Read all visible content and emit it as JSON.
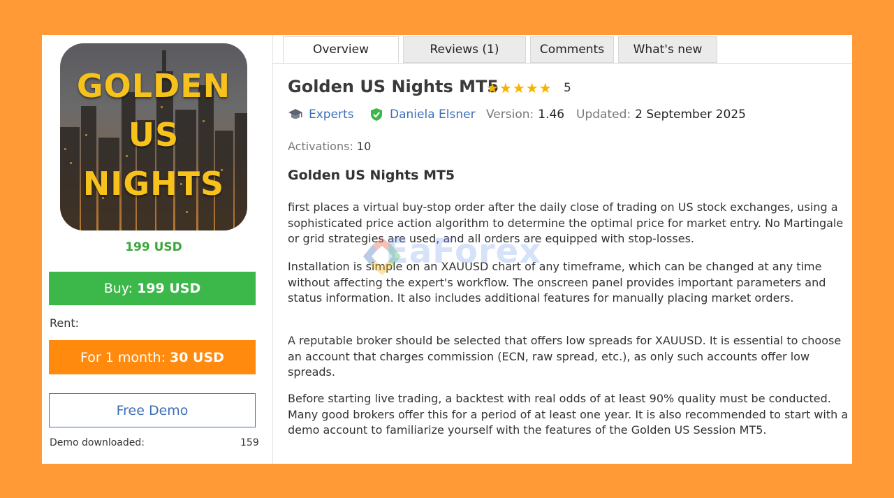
{
  "product": {
    "image_text": [
      "GOLDEN",
      "US",
      "NIGHTS"
    ],
    "price": "199 USD",
    "buy_prefix": "Buy:",
    "buy_price": "199 USD",
    "rent_label": "Rent:",
    "rent_prefix": "For 1 month:",
    "rent_price": "30 USD",
    "demo_button": "Free Demo",
    "demo_downloaded_label": "Demo downloaded:",
    "demo_downloaded_count": "159"
  },
  "tabs": [
    {
      "label": "Overview",
      "active": true
    },
    {
      "label": "Reviews (1)",
      "active": false
    },
    {
      "label": "Comments",
      "active": false
    },
    {
      "label": "What's new",
      "active": false
    }
  ],
  "header": {
    "title": "Golden US Nights MT5",
    "stars": "★★★★★",
    "rating": "5",
    "category": "Experts",
    "author": "Daniela Elsner",
    "version_label": "Version:",
    "version": "1.46",
    "updated_label": "Updated:",
    "updated": "2 September 2025",
    "activations_label": "Activations:",
    "activations": "10"
  },
  "description": {
    "heading": "Golden US Nights MT5",
    "paragraphs": [
      "first places a virtual buy-stop order after the daily close of trading on US stock exchanges, using a sophisticated price action algorithm to determine the optimal price for market entry. No Martingale or grid strategies are used, and all orders are equipped with stop-losses.",
      "Installation is simple on an XAUUSD chart of any timeframe, which can be changed at any time without affecting the expert's workflow. The onscreen panel provides important parameters and status information. It also includes additional features for manually placing market orders.",
      "A reputable broker should be selected that offers low spreads for XAUUSD. It is essential to choose an account that charges commission (ECN, raw spread, etc.), as only such accounts offer low spreads.",
      "Before starting live trading, a backtest with real odds of at least 90% quality must be conducted. Many good brokers offer this for a period of at least one year. It is also recommended to start with a demo account to familiarize yourself with the features of the Golden US Session MT5."
    ]
  },
  "watermark": "EaForex",
  "colors": {
    "background": "#ff9a36",
    "buy": "#3cb84a",
    "rent": "#ff8a0d",
    "link": "#3d6fb6",
    "price": "#3aa63a",
    "star": "#f5b400"
  }
}
